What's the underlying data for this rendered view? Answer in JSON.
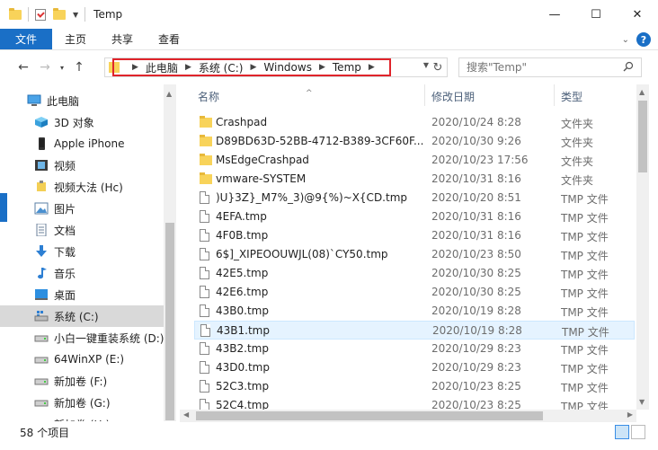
{
  "window": {
    "title": "Temp",
    "minimize": "—",
    "maximize": "☐",
    "close": "✕"
  },
  "ribbon": {
    "tabs": [
      "文件",
      "主页",
      "共享",
      "查看"
    ],
    "help": "?"
  },
  "address": {
    "crumbs": [
      "此电脑",
      "系统 (C:)",
      "Windows",
      "Temp"
    ]
  },
  "search": {
    "placeholder": "搜索\"Temp\""
  },
  "nav_pane": {
    "items": [
      {
        "label": "此电脑",
        "icon": "computer-icon"
      },
      {
        "label": "3D 对象",
        "icon": "cube-icon"
      },
      {
        "label": "Apple iPhone",
        "icon": "phone-icon"
      },
      {
        "label": "视频",
        "icon": "video-icon"
      },
      {
        "label": "视频大法 (Hc)",
        "icon": "usb-drive-icon"
      },
      {
        "label": "图片",
        "icon": "picture-icon"
      },
      {
        "label": "文档",
        "icon": "document-icon"
      },
      {
        "label": "下载",
        "icon": "download-icon"
      },
      {
        "label": "音乐",
        "icon": "music-icon"
      },
      {
        "label": "桌面",
        "icon": "desktop-icon"
      },
      {
        "label": "系统 (C:)",
        "icon": "system-drive-icon"
      },
      {
        "label": "小白一键重装系统 (D:)",
        "icon": "drive-icon"
      },
      {
        "label": "64WinXP  (E:)",
        "icon": "drive-icon"
      },
      {
        "label": "新加卷 (F:)",
        "icon": "drive-icon"
      },
      {
        "label": "新加卷 (G:)",
        "icon": "drive-icon"
      },
      {
        "label": "新加卷 (H:)",
        "icon": "drive-icon"
      }
    ],
    "selected_index": 10
  },
  "columns": {
    "name": "名称",
    "modified": "修改日期",
    "type": "类型"
  },
  "files": [
    {
      "name": "Crashpad",
      "date": "2020/10/24 8:28",
      "type": "文件夹",
      "kind": "folder"
    },
    {
      "name": "D89BD63D-52BB-4712-B389-3CF60F...",
      "date": "2020/10/30 9:26",
      "type": "文件夹",
      "kind": "folder"
    },
    {
      "name": "MsEdgeCrashpad",
      "date": "2020/10/23 17:56",
      "type": "文件夹",
      "kind": "folder"
    },
    {
      "name": "vmware-SYSTEM",
      "date": "2020/10/31 8:16",
      "type": "文件夹",
      "kind": "folder"
    },
    {
      "name": ")U}3Z}_M7%_3)@9{%)~X{CD.tmp",
      "date": "2020/10/20 8:51",
      "type": "TMP 文件",
      "kind": "file"
    },
    {
      "name": "4EFA.tmp",
      "date": "2020/10/31 8:16",
      "type": "TMP 文件",
      "kind": "file"
    },
    {
      "name": "4F0B.tmp",
      "date": "2020/10/31 8:16",
      "type": "TMP 文件",
      "kind": "file"
    },
    {
      "name": "6$]_XIPEOOUWJL(08)`CY50.tmp",
      "date": "2020/10/23 8:50",
      "type": "TMP 文件",
      "kind": "file"
    },
    {
      "name": "42E5.tmp",
      "date": "2020/10/30 8:25",
      "type": "TMP 文件",
      "kind": "file"
    },
    {
      "name": "42E6.tmp",
      "date": "2020/10/30 8:25",
      "type": "TMP 文件",
      "kind": "file"
    },
    {
      "name": "43B0.tmp",
      "date": "2020/10/19 8:28",
      "type": "TMP 文件",
      "kind": "file"
    },
    {
      "name": "43B1.tmp",
      "date": "2020/10/19 8:28",
      "type": "TMP 文件",
      "kind": "file"
    },
    {
      "name": "43B2.tmp",
      "date": "2020/10/29 8:23",
      "type": "TMP 文件",
      "kind": "file"
    },
    {
      "name": "43D0.tmp",
      "date": "2020/10/29 8:23",
      "type": "TMP 文件",
      "kind": "file"
    },
    {
      "name": "52C3.tmp",
      "date": "2020/10/23 8:25",
      "type": "TMP 文件",
      "kind": "file"
    },
    {
      "name": "52C4.tmp",
      "date": "2020/10/23 8:25",
      "type": "TMP 文件",
      "kind": "file"
    }
  ],
  "highlighted_row": 11,
  "status": {
    "count": "58 个项目"
  },
  "colors": {
    "accent": "#1a6fc6",
    "highlight_box": "#e0242b",
    "selection": "#e5f3ff"
  }
}
